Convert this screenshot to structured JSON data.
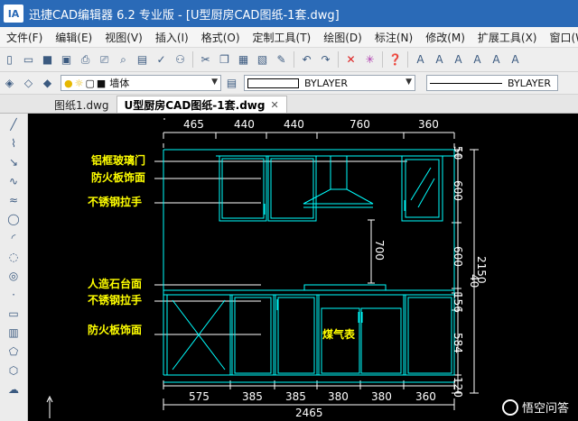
{
  "window": {
    "logo_text": "IA",
    "title": "迅捷CAD编辑器 6.2 专业版  - [U型厨房CAD图纸-1套.dwg]"
  },
  "menu": [
    "文件(F)",
    "编辑(E)",
    "视图(V)",
    "插入(I)",
    "格式(O)",
    "定制工具(T)",
    "绘图(D)",
    "标注(N)",
    "修改(M)",
    "扩展工具(X)",
    "窗口(W)"
  ],
  "toolbar": {
    "layer_value": "墙体",
    "color_value": "BYLAYER",
    "linetype_value": "BYLAYER"
  },
  "tabs": [
    {
      "label": "图纸1.dwg",
      "active": false
    },
    {
      "label": "U型厨房CAD图纸-1套.dwg",
      "active": true
    }
  ],
  "drawing": {
    "top_dims": [
      "465",
      "440",
      "440",
      "760",
      "360"
    ],
    "right_dims": [
      "50",
      "600",
      "600",
      "40",
      "156",
      "584",
      "120"
    ],
    "overall_height": "2150",
    "hood_dim": "700",
    "bottom_dims": [
      "575",
      "385",
      "385",
      "380",
      "380",
      "360"
    ],
    "overall_width": "2465",
    "labels": {
      "aluminum_glass_door": "铝框玻璃门",
      "fireproof_panel_top": "防火板饰面",
      "steel_handle_top": "不锈钢拉手",
      "stone_countertop": "人造石台面",
      "steel_handle_bottom": "不锈钢拉手",
      "fireproof_panel_bottom": "防火板饰面",
      "gas_meter": "煤气表"
    }
  },
  "watermark": "悟空问答",
  "colors": {
    "canvas_bg": "#000000",
    "cabinet_line": "#00ffff",
    "dim_line": "#ffffff",
    "label_text": "#ffff00",
    "title_bar": "#2a6ab7"
  }
}
